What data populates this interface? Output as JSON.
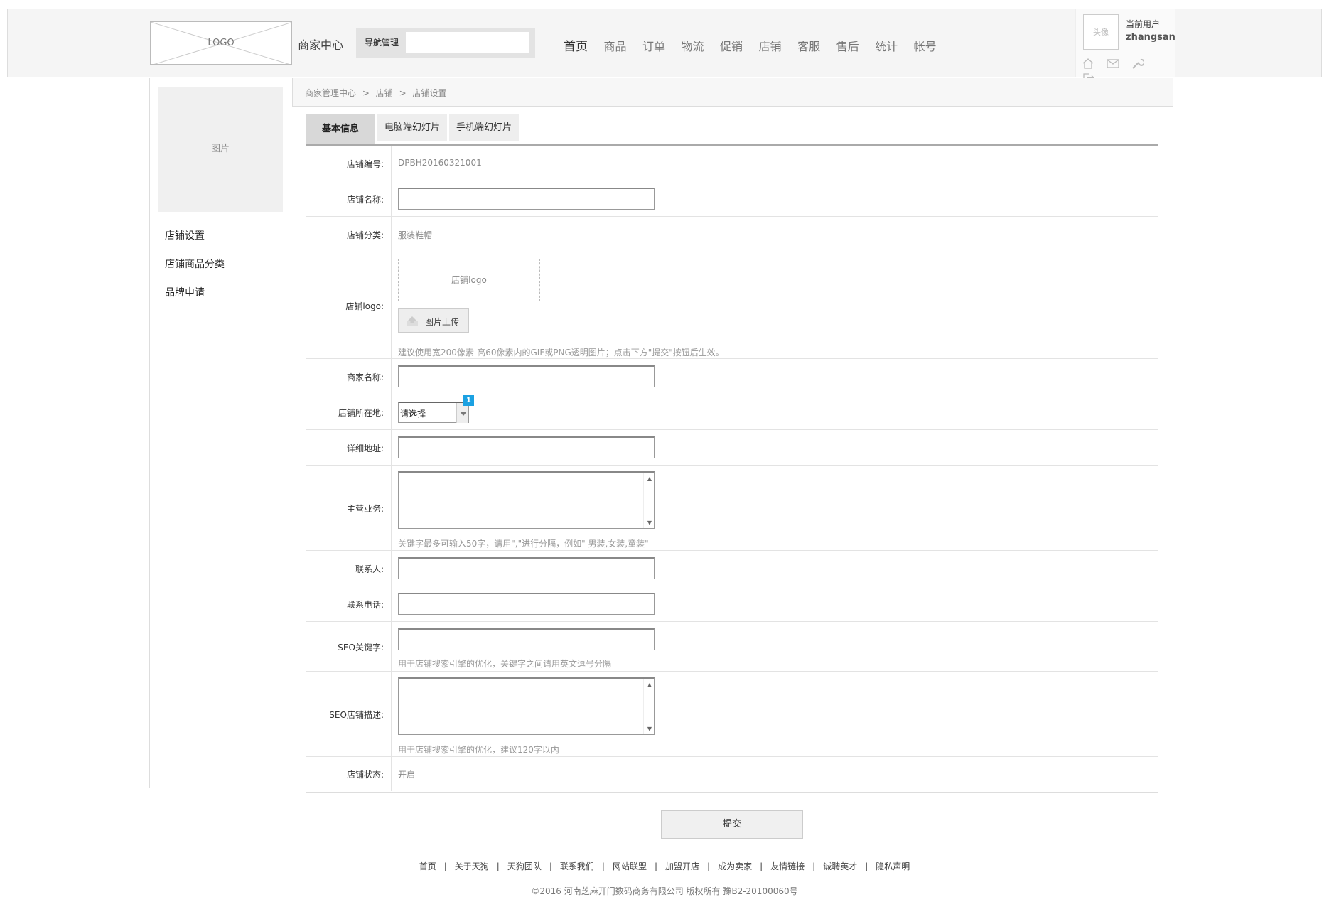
{
  "header": {
    "logo": "LOGO",
    "merchant_center": "商家中心",
    "nav_manage_label": "导航管理",
    "nav": [
      "首页",
      "商品",
      "订单",
      "物流",
      "促销",
      "店铺",
      "客服",
      "售后",
      "统计",
      "帐号"
    ],
    "nav_active": "首页",
    "avatar": "头像",
    "current_user_label": "当前用户",
    "username": "zhangsan",
    "icons": [
      "home-icon",
      "mail-icon",
      "wrench-icon",
      "logout-icon"
    ]
  },
  "sidebar": {
    "image": "图片",
    "items": [
      "店铺设置",
      "店铺商品分类",
      "品牌申请"
    ]
  },
  "breadcrumb": [
    "商家管理中心",
    ">",
    "店铺",
    ">",
    "店铺设置"
  ],
  "tabs": [
    "基本信息",
    "电脑端幻灯片",
    "手机端幻灯片"
  ],
  "form": {
    "store_no_label": "店铺编号:",
    "store_no": "DPBH20160321001",
    "store_name_label": "店铺名称:",
    "store_name": "",
    "category_label": "店铺分类:",
    "category": "服装鞋帽",
    "logo_label": "店铺logo:",
    "logo_placeholder": "店铺logo",
    "upload_button": "图片上传",
    "logo_hint": "建议使用宽200像素-高60像素内的GIF或PNG透明图片；点击下方\"提交\"按钮后生效。",
    "merchant_name_label": "商家名称:",
    "merchant_name": "",
    "location_label": "店铺所在地:",
    "location_select": "请选择",
    "location_badge": "1",
    "address_label": "详细地址:",
    "address": "",
    "business_label": "主营业务:",
    "business_hint": "关键字最多可输入50字，请用\",\"进行分隔，例如\" 男装,女装,童装\"",
    "contact_label": "联系人:",
    "phone_label": "联系电话:",
    "seo_kw_label": "SEO关键字:",
    "seo_kw_hint": "用于店铺搜索引擎的优化，关键字之间请用英文逗号分隔",
    "seo_desc_label": "SEO店铺描述:",
    "seo_desc_hint": "用于店铺搜索引擎的优化，建议120字以内",
    "status_label": "店铺状态:",
    "status": "开启"
  },
  "submit": "提交",
  "footer": {
    "links": [
      "首页",
      "关于天狗",
      "天狗团队",
      "联系我们",
      "网站联盟",
      "加盟开店",
      "成为卖家",
      "友情链接",
      "诚聘英才",
      "隐私声明"
    ],
    "separator": "|",
    "copyright": "©2016 河南芝麻开门数码商务有限公司 版权所有 豫B2-20100060号"
  }
}
